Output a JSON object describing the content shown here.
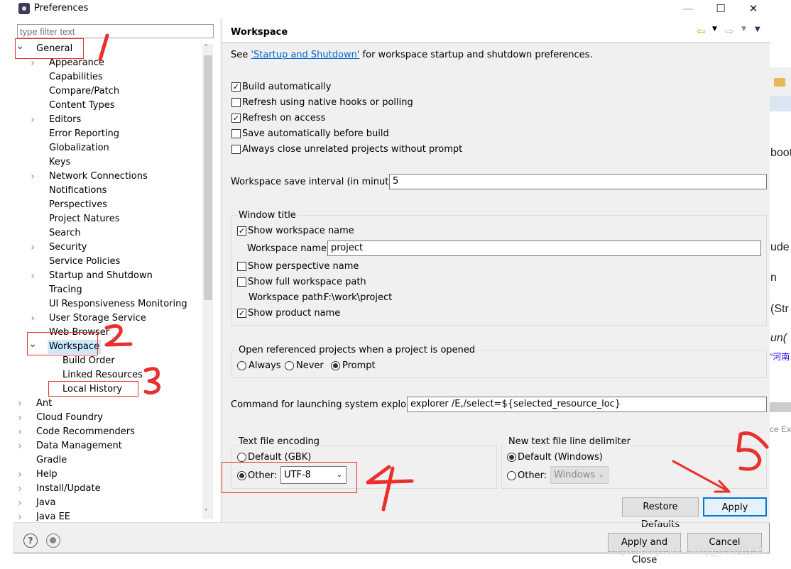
{
  "window": {
    "title": "Preferences",
    "minimize": "—",
    "maximize": "☐",
    "close": "✕"
  },
  "filter": {
    "placeholder": "type filter text"
  },
  "tree": [
    {
      "label": "General",
      "level": 0,
      "twisty": "expanded"
    },
    {
      "label": "Appearance",
      "level": 1,
      "twisty": "collapsed"
    },
    {
      "label": "Capabilities",
      "level": 1
    },
    {
      "label": "Compare/Patch",
      "level": 1
    },
    {
      "label": "Content Types",
      "level": 1
    },
    {
      "label": "Editors",
      "level": 1,
      "twisty": "collapsed"
    },
    {
      "label": "Error Reporting",
      "level": 1
    },
    {
      "label": "Globalization",
      "level": 1
    },
    {
      "label": "Keys",
      "level": 1
    },
    {
      "label": "Network Connections",
      "level": 1,
      "twisty": "collapsed"
    },
    {
      "label": "Notifications",
      "level": 1
    },
    {
      "label": "Perspectives",
      "level": 1
    },
    {
      "label": "Project Natures",
      "level": 1
    },
    {
      "label": "Search",
      "level": 1
    },
    {
      "label": "Security",
      "level": 1,
      "twisty": "collapsed"
    },
    {
      "label": "Service Policies",
      "level": 1
    },
    {
      "label": "Startup and Shutdown",
      "level": 1,
      "twisty": "collapsed"
    },
    {
      "label": "Tracing",
      "level": 1
    },
    {
      "label": "UI Responsiveness Monitoring",
      "level": 1
    },
    {
      "label": "User Storage Service",
      "level": 1,
      "twisty": "collapsed"
    },
    {
      "label": "Web Browser",
      "level": 1
    },
    {
      "label": "Workspace",
      "level": 1,
      "twisty": "expanded",
      "selected": true
    },
    {
      "label": "Build Order",
      "level": 2
    },
    {
      "label": "Linked Resources",
      "level": 2
    },
    {
      "label": "Local History",
      "level": 2
    },
    {
      "label": "Ant",
      "level": 0,
      "twisty": "collapsed"
    },
    {
      "label": "Cloud Foundry",
      "level": 0,
      "twisty": "collapsed"
    },
    {
      "label": "Code Recommenders",
      "level": 0,
      "twisty": "collapsed"
    },
    {
      "label": "Data Management",
      "level": 0,
      "twisty": "collapsed"
    },
    {
      "label": "Gradle",
      "level": 0
    },
    {
      "label": "Help",
      "level": 0,
      "twisty": "collapsed"
    },
    {
      "label": "Install/Update",
      "level": 0,
      "twisty": "collapsed"
    },
    {
      "label": "Java",
      "level": 0,
      "twisty": "collapsed"
    },
    {
      "label": "Java EE",
      "level": 0,
      "twisty": "collapsed"
    }
  ],
  "page": {
    "title": "Workspace",
    "intro_pre": "See ",
    "intro_link": "'Startup and Shutdown'",
    "intro_post": " for workspace startup and shutdown preferences.",
    "checks": [
      {
        "label": "Build automatically",
        "checked": true
      },
      {
        "label": "Refresh using native hooks or polling",
        "checked": false
      },
      {
        "label": "Refresh on access",
        "checked": true
      },
      {
        "label": "Save automatically before build",
        "checked": false
      },
      {
        "label": "Always close unrelated projects without prompt",
        "checked": false
      }
    ],
    "save_interval_label": "Workspace save interval (in minutes):",
    "save_interval_value": "5",
    "window_title": {
      "group": "Window title",
      "show_ws_name": "Show workspace name",
      "ws_name_label": "Workspace name:",
      "ws_name_value": "project",
      "show_persp": "Show perspective name",
      "show_path": "Show full workspace path",
      "ws_path_label": "Workspace path:",
      "ws_path_value": "F:\\work\\project",
      "show_product": "Show product name"
    },
    "open_ref": {
      "group": "Open referenced projects when a project is opened",
      "options": [
        "Always",
        "Never",
        "Prompt"
      ],
      "selected": "Prompt"
    },
    "cmd_label": "Command for launching system explorer:",
    "cmd_value": "explorer /E,/select=${selected_resource_loc}",
    "encoding": {
      "group": "Text file encoding",
      "default": "Default (GBK)",
      "other": "Other:",
      "value": "UTF-8",
      "selected": "Other"
    },
    "delimiter": {
      "group": "New text file line delimiter",
      "default": "Default (Windows)",
      "other": "Other:",
      "value": "Windows",
      "selected": "Default"
    },
    "restore": "Restore Defaults",
    "apply": "Apply"
  },
  "footer": {
    "apply_close": "Apply and Close",
    "cancel": "Cancel",
    "help": "?",
    "watermark": "https://blog.csdn.net/qq_43628158"
  },
  "background_code": [
    "boot",
    "ude",
    "n",
    "(Str",
    "un(",
    "\"河南"
  ],
  "background_tab": "ce Ex",
  "annotations": [
    "1",
    "2",
    "3",
    "4",
    "5"
  ],
  "colors": {
    "annotation": "#e8302c",
    "selection": "#cce8ff",
    "link": "#0066cc"
  }
}
